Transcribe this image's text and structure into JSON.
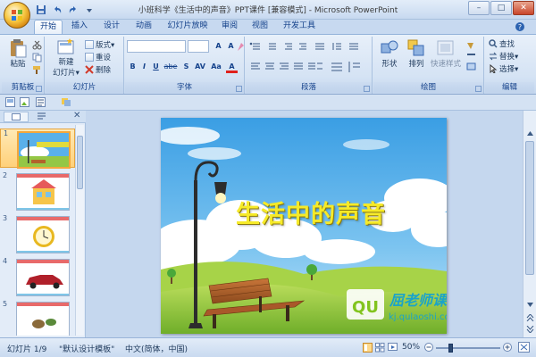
{
  "window": {
    "title": "小班科学《生活中的声音》PPT课件 [兼容模式] - Microsoft PowerPoint",
    "controls": [
      "–",
      "□",
      "✕"
    ]
  },
  "tabs": [
    {
      "label": "开始",
      "active": true
    },
    {
      "label": "插入"
    },
    {
      "label": "设计"
    },
    {
      "label": "动画"
    },
    {
      "label": "幻灯片放映"
    },
    {
      "label": "审阅"
    },
    {
      "label": "视图"
    },
    {
      "label": "开发工具"
    }
  ],
  "ribbon": {
    "clipboard": {
      "label": "剪贴板",
      "paste": "粘贴"
    },
    "slides": {
      "label": "幻灯片",
      "new_slide_line1": "新建",
      "new_slide_line2": "幻灯片▾",
      "layout": "版式▾",
      "reset": "重设",
      "delete": "删除"
    },
    "font": {
      "label": "字体",
      "bold": "B",
      "italic": "I",
      "underline": "U",
      "strike": "abe",
      "shadow": "S",
      "spacing": "AV",
      "case": "Aa",
      "color": "A"
    },
    "paragraph": {
      "label": "段落"
    },
    "drawing": {
      "label": "绘图",
      "shapes": "形状",
      "arrange": "排列",
      "quick_styles": "快速样式"
    },
    "editing": {
      "label": "编辑",
      "find": "查找",
      "replace": "替换▾",
      "select": "选择▾"
    }
  },
  "panel": {
    "close": "✕",
    "slides": [
      {
        "num": "1",
        "active": true
      },
      {
        "num": "2"
      },
      {
        "num": "3"
      },
      {
        "num": "4"
      },
      {
        "num": "5"
      }
    ]
  },
  "slide": {
    "title": "生活中的声音",
    "watermark_brand": "屈老师课件",
    "watermark_logo": "QU",
    "watermark_url": "kj.qulaoshi.com"
  },
  "status": {
    "slide_counter": "幻灯片 1/9",
    "theme": "\"默认设计模板\"",
    "language": "中文(简体，中国)",
    "zoom": "50%",
    "zoom_fraction": 0.5
  },
  "colors": {
    "accent": "#15428b",
    "title_yellow": "#f6ea28",
    "sky": "#3a9ee4",
    "grass": "#8cc43a",
    "watermark": "#1aa3c9"
  }
}
